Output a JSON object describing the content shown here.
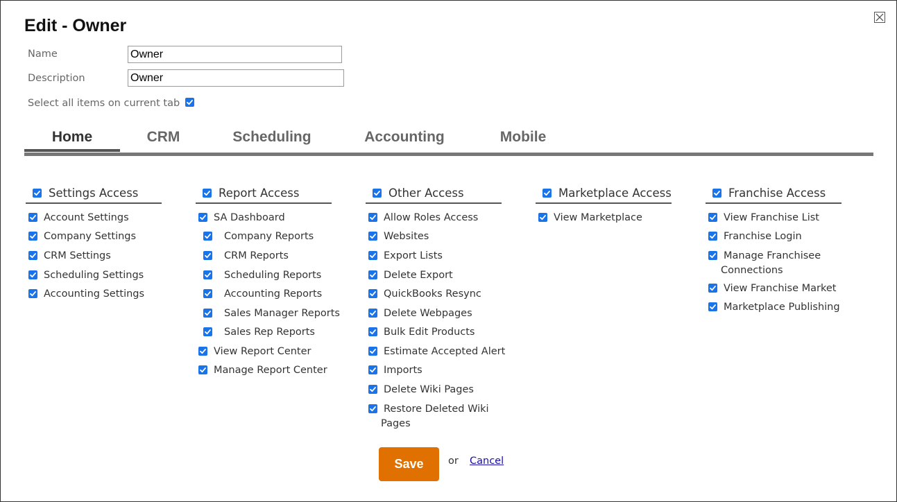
{
  "dialog": {
    "title": "Edit - Owner",
    "name_label": "Name",
    "name_value": "Owner",
    "description_label": "Description",
    "description_value": "Owner",
    "select_all_label": "Select all items on current tab",
    "select_all_checked": true
  },
  "tabs": [
    {
      "label": "Home",
      "active": true
    },
    {
      "label": "CRM",
      "active": false
    },
    {
      "label": "Scheduling",
      "active": false
    },
    {
      "label": "Accounting",
      "active": false
    },
    {
      "label": "Mobile",
      "active": false
    }
  ],
  "columns": [
    {
      "header": "Settings Access",
      "items": [
        {
          "label": "Account Settings"
        },
        {
          "label": "Company Settings"
        },
        {
          "label": "CRM Settings"
        },
        {
          "label": "Scheduling Settings"
        },
        {
          "label": "Accounting Settings"
        }
      ]
    },
    {
      "header": "Report Access",
      "items": [
        {
          "label": "SA Dashboard"
        },
        {
          "label": "Company Reports"
        },
        {
          "label": "CRM Reports"
        },
        {
          "label": "Scheduling Reports"
        },
        {
          "label": "Accounting Reports"
        },
        {
          "label": "Sales Manager Reports"
        },
        {
          "label": "Sales Rep Reports"
        },
        {
          "label": "View Report Center"
        },
        {
          "label": "Manage Report Center"
        }
      ]
    },
    {
      "header": "Other Access",
      "items": [
        {
          "label": "Allow Roles Access"
        },
        {
          "label": "Websites"
        },
        {
          "label": "Export Lists"
        },
        {
          "label": "Delete Export"
        },
        {
          "label": "QuickBooks Resync"
        },
        {
          "label": "Delete Webpages"
        },
        {
          "label": "Bulk Edit Products"
        },
        {
          "label": "Estimate Accepted Alert"
        },
        {
          "label": "Imports"
        },
        {
          "label": "Delete Wiki Pages"
        },
        {
          "label": "Restore Deleted Wiki",
          "label2": "Pages"
        }
      ]
    },
    {
      "header": "Marketplace Access",
      "items": [
        {
          "label": "View Marketplace"
        }
      ]
    },
    {
      "header": "Franchise Access",
      "items": [
        {
          "label": "View Franchise List"
        },
        {
          "label": "Franchise Login"
        },
        {
          "label": "Manage Franchisee",
          "label2": "Connections"
        },
        {
          "label": "View Franchise Market"
        },
        {
          "label": "Marketplace Publishing"
        }
      ]
    }
  ],
  "actions": {
    "save_label": "Save",
    "or_text": "or",
    "cancel_label": "Cancel"
  },
  "colors": {
    "accent": "#e07000",
    "checkbox": "#1a73e8",
    "link": "#1a0dab"
  },
  "icons": {
    "close": "close-icon",
    "checkbox": "checkbox-checked-icon"
  }
}
